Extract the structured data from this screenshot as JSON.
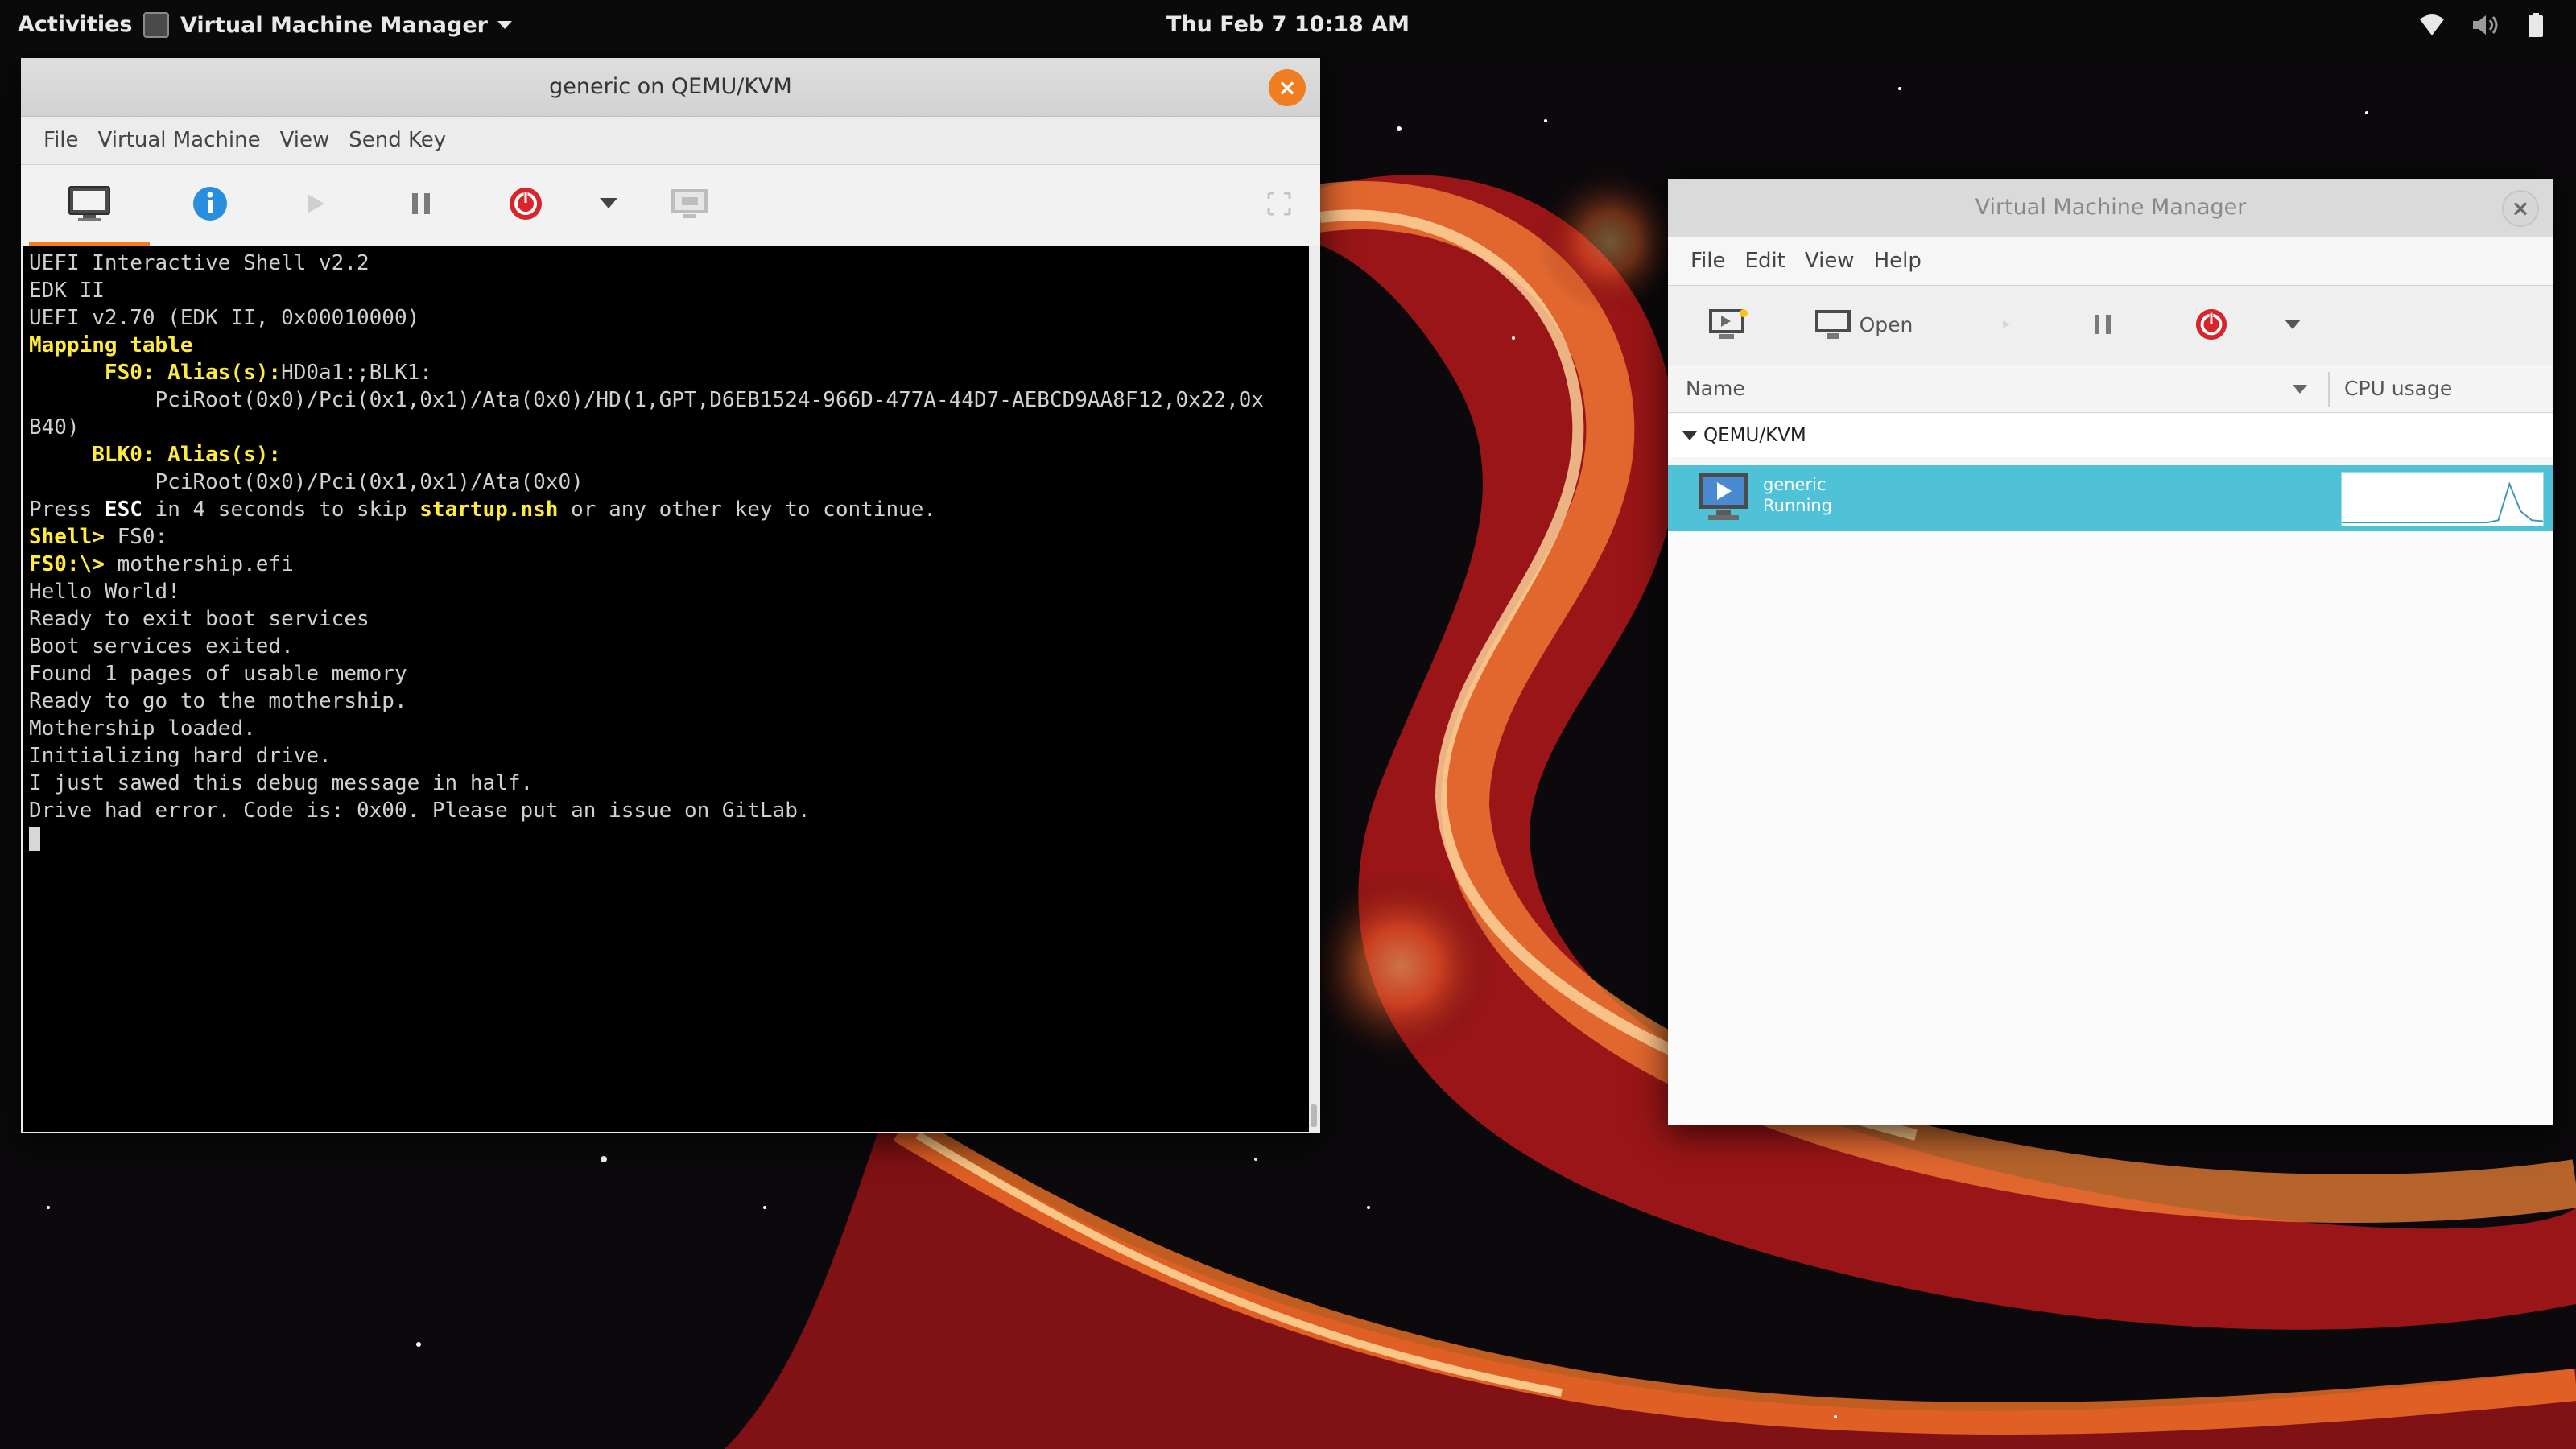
{
  "topbar": {
    "activities": "Activities",
    "app_name": "Virtual Machine Manager",
    "clock": "Thu Feb 7  10:18 AM"
  },
  "console_window": {
    "title": "generic on QEMU/KVM",
    "close": "×",
    "menu": [
      "File",
      "Virtual Machine",
      "View",
      "Send Key"
    ],
    "toolbar_icons": [
      "monitor-icon",
      "info-icon",
      "play-icon",
      "pause-icon",
      "power-icon",
      "dropdown-icon",
      "screenshot-icon",
      "fullscreen-icon"
    ],
    "lines": [
      [
        {
          "t": "UEFI Interactive Shell v2.2",
          "s": ""
        }
      ],
      [
        {
          "t": "EDK II",
          "s": ""
        }
      ],
      [
        {
          "t": "UEFI v2.70 (EDK II, 0x00010000)",
          "s": ""
        }
      ],
      [
        {
          "t": "Mapping table",
          "s": "y"
        }
      ],
      [
        {
          "t": "      FS0: Alias(s):",
          "s": "y"
        },
        {
          "t": "HD0a1:;BLK1:",
          "s": ""
        }
      ],
      [
        {
          "t": "          PciRoot(0x0)/Pci(0x1,0x1)/Ata(0x0)/HD(1,GPT,D6EB1524-966D-477A-44D7-AEBCD9AA8F12,0x22,0x",
          "s": ""
        }
      ],
      [
        {
          "t": "B40)",
          "s": ""
        }
      ],
      [
        {
          "t": "     BLK0: Alias(s):",
          "s": "y"
        }
      ],
      [
        {
          "t": "          PciRoot(0x0)/Pci(0x1,0x1)/Ata(0x0)",
          "s": ""
        }
      ],
      [
        {
          "t": "Press ",
          "s": ""
        },
        {
          "t": "ESC",
          "s": "w"
        },
        {
          "t": " in 4 seconds to skip ",
          "s": ""
        },
        {
          "t": "startup.nsh",
          "s": "y"
        },
        {
          "t": " or any other key to continue.",
          "s": ""
        }
      ],
      [
        {
          "t": "Shell> ",
          "s": "y"
        },
        {
          "t": "FS0:",
          "s": ""
        }
      ],
      [
        {
          "t": "FS0:\\> ",
          "s": "y"
        },
        {
          "t": "mothership.efi",
          "s": ""
        }
      ],
      [
        {
          "t": "Hello World!",
          "s": ""
        }
      ],
      [
        {
          "t": "Ready to exit boot services",
          "s": ""
        }
      ],
      [
        {
          "t": "Boot services exited.",
          "s": ""
        }
      ],
      [
        {
          "t": "Found 1 pages of usable memory",
          "s": ""
        }
      ],
      [
        {
          "t": "Ready to go to the mothership.",
          "s": ""
        }
      ],
      [
        {
          "t": "Mothership loaded.",
          "s": ""
        }
      ],
      [
        {
          "t": "Initializing hard drive.",
          "s": ""
        }
      ],
      [
        {
          "t": "I just sawed this debug message in half.",
          "s": ""
        }
      ],
      [
        {
          "t": "Drive had error. Code is: 0x00. Please put an issue on GitLab.",
          "s": ""
        }
      ]
    ]
  },
  "vmm_window": {
    "title": "Virtual Machine Manager",
    "close": "×",
    "menu": [
      "File",
      "Edit",
      "View",
      "Help"
    ],
    "toolbar": {
      "open_label": "Open"
    },
    "columns": {
      "name": "Name",
      "cpu": "CPU usage"
    },
    "group": "QEMU/KVM",
    "vm": {
      "name": "generic",
      "state": "Running",
      "cpu_history": [
        0,
        0,
        0,
        0,
        0,
        0,
        0,
        0,
        0,
        0,
        0,
        0,
        0,
        0,
        0.05,
        0.85,
        0.25,
        0.05,
        0.03
      ]
    }
  },
  "colors": {
    "accent": "#f07d1f",
    "selection": "#4fc2d8",
    "console_yellow": "#ffeb3b"
  }
}
